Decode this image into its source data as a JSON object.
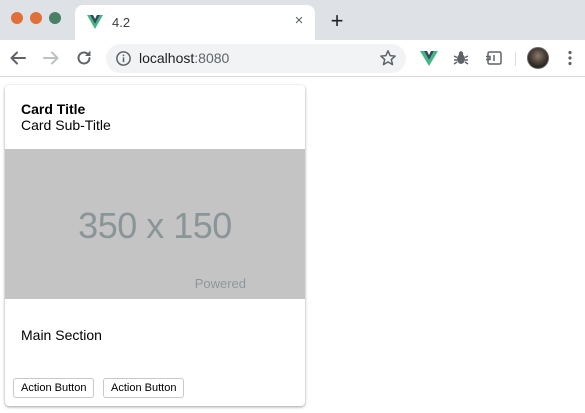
{
  "browser": {
    "tab": {
      "title": "4.2",
      "favicon": "vue-logo-icon",
      "close": "×"
    },
    "new_tab": "+",
    "address": {
      "host": "localhost",
      "port": ":8080"
    },
    "colors": {
      "vue_green": "#41b883",
      "vue_dark": "#35495e",
      "tab_strip": "#dee1e6"
    }
  },
  "card": {
    "title": "Card Title",
    "subtitle": "Card Sub-Title",
    "media": {
      "size_text": "350 x 150",
      "overlay_text": "Powered"
    },
    "main_section": "Main Section",
    "actions": [
      {
        "label": "Action Button"
      },
      {
        "label": "Action Button"
      }
    ]
  }
}
